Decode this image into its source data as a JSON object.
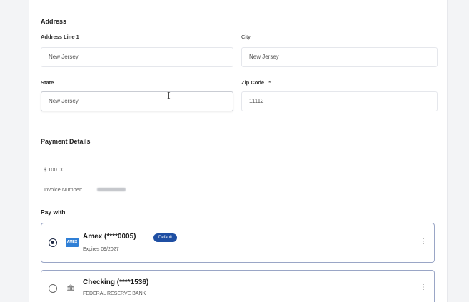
{
  "address": {
    "section_title": "Address",
    "line1_label": "Address Line 1",
    "line1_value": "New Jersey",
    "city_label": "City",
    "city_value": "New Jersey",
    "state_label": "State",
    "state_value": "New Jersey",
    "zip_label": "Zip Code",
    "zip_required": "*",
    "zip_value": "11112"
  },
  "payment": {
    "section_title": "Payment Details",
    "amount": "$ 100.00",
    "invoice_label": "Invoice Number:",
    "pay_with_label": "Pay with",
    "methods": [
      {
        "title": "Amex (****0005)",
        "subtitle": "Expires 09/2027",
        "badge": "Default",
        "icon": "amex-card-icon",
        "selected": true
      },
      {
        "title": "Checking (****1536)",
        "subtitle": "FEDERAL RESERVE BANK",
        "icon": "bank-icon",
        "selected": false
      }
    ]
  },
  "colors": {
    "accent": "#1f4fa3",
    "card_border": "#9aa6c6",
    "amex_blue": "#2f7fd6"
  }
}
